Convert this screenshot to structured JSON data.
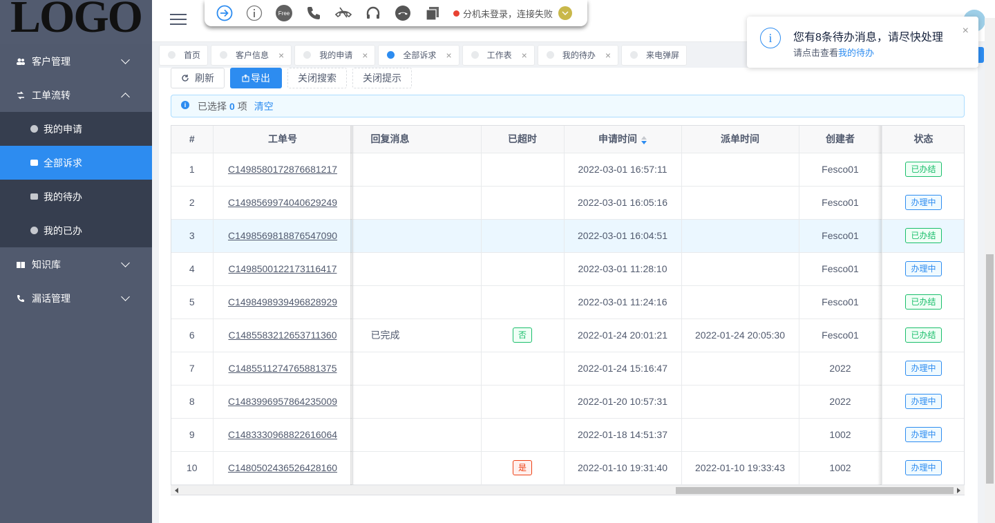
{
  "logo": "LOGO",
  "sidebar": {
    "menus": [
      {
        "label": "客户管理",
        "icon": "users-icon",
        "expanded": false
      },
      {
        "label": "工单流转",
        "icon": "workflow-icon",
        "expanded": true
      },
      {
        "label": "知识库",
        "icon": "book-icon",
        "expanded": false
      },
      {
        "label": "漏话管理",
        "icon": "phone-icon",
        "expanded": false
      }
    ],
    "sub_items": [
      {
        "label": "我的申请"
      },
      {
        "label": "全部诉求",
        "active": true
      },
      {
        "label": "我的待办"
      },
      {
        "label": "我的已办"
      }
    ]
  },
  "phonebar": {
    "free_label": "Free",
    "status_text": "分机未登录，连接失败"
  },
  "tabs": [
    {
      "label": "首页",
      "closable": false
    },
    {
      "label": "客户信息",
      "closable": true
    },
    {
      "label": "我的申请",
      "closable": true
    },
    {
      "label": "全部诉求",
      "closable": true,
      "active": true
    },
    {
      "label": "工作表",
      "closable": true
    },
    {
      "label": "我的待办",
      "closable": true
    },
    {
      "label": "来电弹屏",
      "closable": false
    }
  ],
  "toolbar": {
    "refresh": "刷新",
    "export": "导出",
    "close_search": "关闭搜索",
    "close_tips": "关闭提示"
  },
  "alert": {
    "prefix": "已选择",
    "count": "0",
    "suffix": "项",
    "clear": "清空"
  },
  "table": {
    "columns": [
      "#",
      "工单号",
      "回复消息",
      "已超时",
      "申请时间",
      "派单时间",
      "创建者",
      "状态"
    ],
    "rows": [
      {
        "idx": "1",
        "order": "C1498580172876681217",
        "reply": "",
        "overdue": "",
        "apply_time": "2022-03-01 16:57:11",
        "dispatch_time": "",
        "creator": "Fesco01",
        "status": "已办结"
      },
      {
        "idx": "2",
        "order": "C1498569974040629249",
        "reply": "",
        "overdue": "",
        "apply_time": "2022-03-01 16:05:16",
        "dispatch_time": "",
        "creator": "Fesco01",
        "status": "办理中"
      },
      {
        "idx": "3",
        "order": "C1498569818876547090",
        "reply": "",
        "overdue": "",
        "apply_time": "2022-03-01 16:04:51",
        "dispatch_time": "",
        "creator": "Fesco01",
        "status": "已办结"
      },
      {
        "idx": "4",
        "order": "C1498500122173116417",
        "reply": "",
        "overdue": "",
        "apply_time": "2022-03-01 11:28:10",
        "dispatch_time": "",
        "creator": "Fesco01",
        "status": "办理中"
      },
      {
        "idx": "5",
        "order": "C1498498939496828929",
        "reply": "",
        "overdue": "",
        "apply_time": "2022-03-01 11:24:16",
        "dispatch_time": "",
        "creator": "Fesco01",
        "status": "已办结"
      },
      {
        "idx": "6",
        "order": "C1485583212653711360",
        "reply": "已完成",
        "overdue": "否",
        "apply_time": "2022-01-24 20:01:21",
        "dispatch_time": "2022-01-24 20:05:30",
        "creator": "Fesco01",
        "status": "已办结"
      },
      {
        "idx": "7",
        "order": "C1485511274765881375",
        "reply": "",
        "overdue": "",
        "apply_time": "2022-01-24 15:16:47",
        "dispatch_time": "",
        "creator": "2022",
        "status": "办理中"
      },
      {
        "idx": "8",
        "order": "C1483996957864235009",
        "reply": "",
        "overdue": "",
        "apply_time": "2022-01-20 10:57:31",
        "dispatch_time": "",
        "creator": "2022",
        "status": "办理中"
      },
      {
        "idx": "9",
        "order": "C1483330968822616064",
        "reply": "",
        "overdue": "",
        "apply_time": "2022-01-18 14:51:37",
        "dispatch_time": "",
        "creator": "1002",
        "status": "办理中"
      },
      {
        "idx": "10",
        "order": "C1480502436526428160",
        "reply": "",
        "overdue": "是",
        "apply_time": "2022-01-10 19:31:40",
        "dispatch_time": "2022-01-10 19:33:43",
        "creator": "1002",
        "status": "办理中"
      }
    ]
  },
  "notification": {
    "title": "您有8条待办消息，请尽快处理",
    "desc_prefix": "请点击查看",
    "desc_link": "我的待办"
  },
  "colors": {
    "accent": "#2d8cf0",
    "sidebar": "#515a6e",
    "done": "#19be6b",
    "danger": "#ed4014"
  }
}
